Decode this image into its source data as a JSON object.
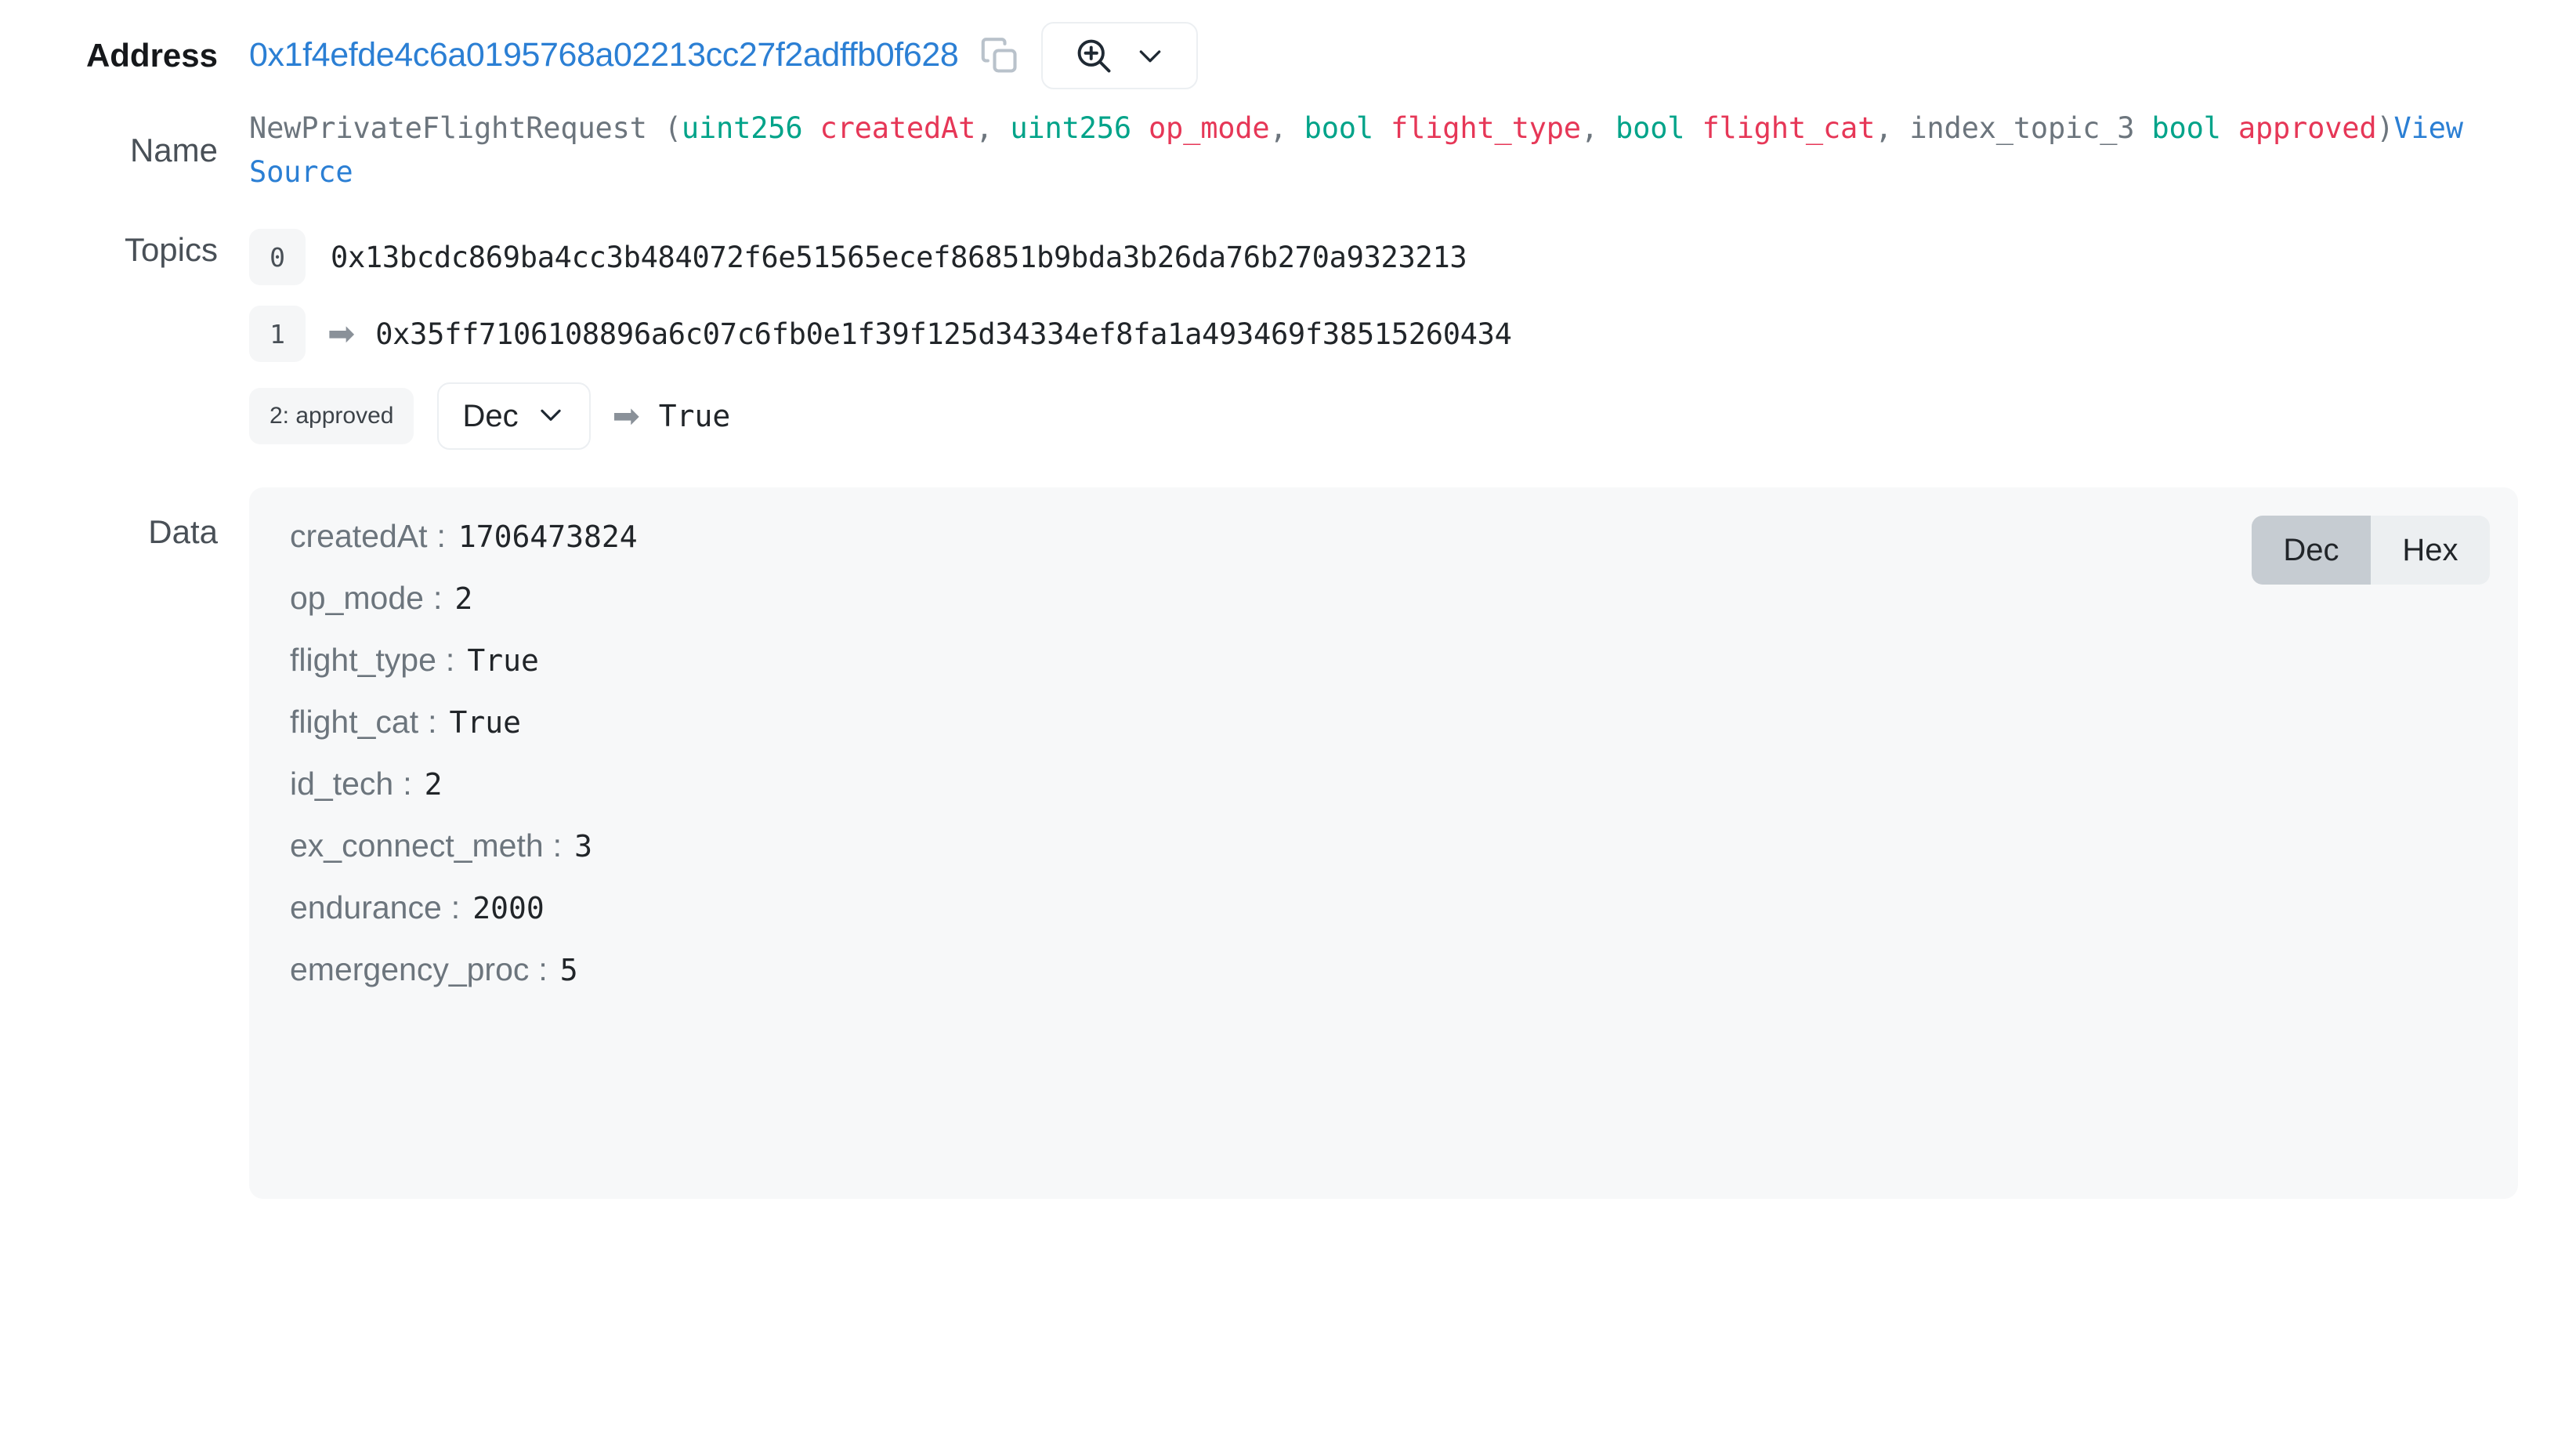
{
  "labels": {
    "address": "Address",
    "name": "Name",
    "topics": "Topics",
    "data": "Data"
  },
  "address": {
    "value": "0x1f4efde4c6a0195768a02213cc27f2adffb0f628",
    "copy_icon": "copy-icon",
    "magnifier_icon": "magnify-plus-icon",
    "chevron_icon": "chevron-down-icon"
  },
  "name": {
    "event": "NewPrivateFlightRequest",
    "open_paren": " (",
    "close_paren": ")",
    "params": [
      {
        "type": "uint256",
        "name": "createdAt",
        "sep": ", "
      },
      {
        "type": "uint256",
        "name": "op_mode",
        "sep": ", "
      },
      {
        "type": "bool",
        "name": "flight_type",
        "sep": ", "
      },
      {
        "type": "bool",
        "name": "flight_cat",
        "sep": ", "
      },
      {
        "type": "bool",
        "name": "approved",
        "sep": "",
        "index_prefix": "index_topic_3"
      }
    ],
    "view_source": "View Source"
  },
  "topics": {
    "rows": [
      {
        "index": "0",
        "hash": "0x13bcdc869ba4cc3b484072f6e51565ecef86851b9bda3b26da76b270a9323213",
        "has_arrow": false
      },
      {
        "index": "1",
        "hash": "0x35ff7106108896a6c07c6fb0e1f39f125d34334ef8fa1a493469f38515260434",
        "has_arrow": true,
        "arrow": "➡"
      }
    ],
    "decoded": {
      "badge": "2: approved",
      "format_label": "Dec",
      "chevron_icon": "chevron-down-icon",
      "arrow": "➡",
      "value": "True"
    }
  },
  "data": {
    "format_toggle": {
      "options": [
        "Dec",
        "Hex"
      ],
      "active": "Dec"
    },
    "fields": [
      {
        "key": "createdAt",
        "value": "1706473824"
      },
      {
        "key": "op_mode",
        "value": "2"
      },
      {
        "key": "flight_type",
        "value": "True"
      },
      {
        "key": "flight_cat",
        "value": "True"
      },
      {
        "key": "id_tech",
        "value": "2"
      },
      {
        "key": "ex_connect_meth",
        "value": "3"
      },
      {
        "key": "endurance",
        "value": "2000"
      },
      {
        "key": "emergency_proc",
        "value": "5"
      }
    ],
    "separator": ":"
  },
  "colors": {
    "link": "#2b7fd4",
    "type": "#00a389",
    "param": "#e63757",
    "muted": "#6c757d",
    "panel_bg": "#f7f8f9",
    "badge_bg": "#f5f6f7",
    "toggle_active_bg": "#c6ccd2",
    "toggle_inactive_bg": "#eceff1"
  }
}
